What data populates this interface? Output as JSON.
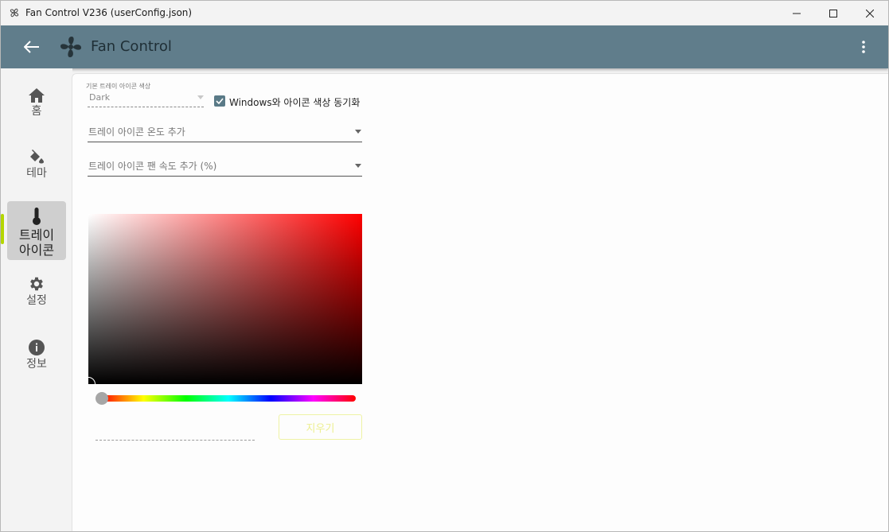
{
  "window": {
    "title": "Fan Control V236 (userConfig.json)"
  },
  "appbar": {
    "title": "Fan Control",
    "color": "#607d8b"
  },
  "sidebar": {
    "items": [
      {
        "label": "홈",
        "icon": "home-icon"
      },
      {
        "label": "테마",
        "icon": "paint-bucket-icon"
      },
      {
        "label": "트레이\n아이콘",
        "icon": "thermometer-icon",
        "active": true
      },
      {
        "label": "설정",
        "icon": "gear-icon"
      },
      {
        "label": "정보",
        "icon": "info-icon"
      }
    ],
    "active_indicator_color": "#b4d600"
  },
  "tray": {
    "default_color_label": "기본 트레이 아이콘 색상",
    "default_color_value": "Dark",
    "sync_label": "Windows와 아이콘 색상 동기화",
    "sync_checked": true,
    "temp_placeholder": "트레이 아이콘 온도 추가",
    "speed_placeholder": "트레이 아이콘 팬 속도 추가 (%)",
    "clear_label": "지우기",
    "hex_value": ""
  },
  "color_picker": {
    "hue_color": "#ff0000",
    "hue_position": 0,
    "saturation": 0,
    "value": 0
  }
}
